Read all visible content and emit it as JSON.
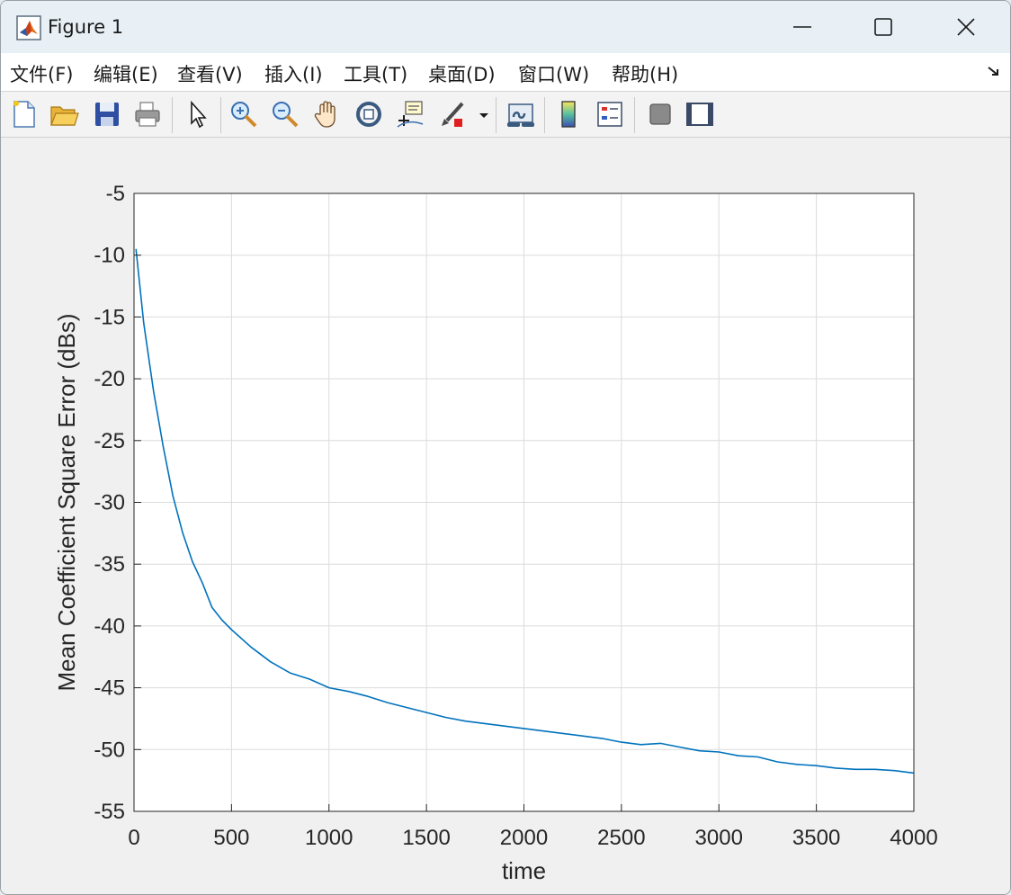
{
  "window": {
    "title": "Figure 1",
    "controls": {
      "minimize": "minimize",
      "maximize": "maximize",
      "close": "close"
    }
  },
  "menu": [
    {
      "label": "文件(F)"
    },
    {
      "label": "编辑(E)"
    },
    {
      "label": "查看(V)"
    },
    {
      "label": "插入(I)"
    },
    {
      "label": "工具(T)"
    },
    {
      "label": "桌面(D)"
    },
    {
      "label": "窗口(W)"
    },
    {
      "label": "帮助(H)"
    }
  ],
  "toolbar": [
    {
      "icon": "new-figure-icon"
    },
    {
      "icon": "open-folder-icon"
    },
    {
      "icon": "save-icon"
    },
    {
      "icon": "print-icon"
    },
    {
      "icon": "pointer-icon"
    },
    {
      "icon": "zoom-in-icon"
    },
    {
      "icon": "zoom-out-icon"
    },
    {
      "icon": "pan-hand-icon"
    },
    {
      "icon": "rotate-3d-icon"
    },
    {
      "icon": "data-cursor-icon"
    },
    {
      "icon": "brush-icon"
    },
    {
      "icon": "link-plot-icon"
    },
    {
      "icon": "colorbar-icon"
    },
    {
      "icon": "legend-icon"
    },
    {
      "icon": "hide-plot-tools-icon"
    },
    {
      "icon": "show-plot-tools-icon"
    }
  ],
  "colors": {
    "line": "#0072bd",
    "grid": "#dcdcdc",
    "axes": "#262626"
  },
  "chart_data": {
    "type": "line",
    "title": "",
    "xlabel": "time",
    "ylabel": "Mean Coefficient Square Error (dBs)",
    "xlim": [
      0,
      4000
    ],
    "ylim": [
      -55,
      -5
    ],
    "xticks": [
      "0",
      "500",
      "1000",
      "1500",
      "2000",
      "2500",
      "3000",
      "3500",
      "4000"
    ],
    "yticks": [
      "-5",
      "-10",
      "-15",
      "-20",
      "-25",
      "-30",
      "-35",
      "-40",
      "-45",
      "-50",
      "-55"
    ],
    "grid": true,
    "series": [
      {
        "x": [
          10,
          50,
          100,
          150,
          200,
          250,
          300,
          350,
          400,
          450,
          500,
          600,
          700,
          800,
          900,
          1000,
          1100,
          1200,
          1300,
          1400,
          1500,
          1600,
          1700,
          1800,
          1900,
          2000,
          2100,
          2200,
          2300,
          2400,
          2500,
          2600,
          2700,
          2800,
          2900,
          3000,
          3100,
          3200,
          3300,
          3400,
          3500,
          3600,
          3700,
          3800,
          3900,
          4000
        ],
        "y": [
          -9.5,
          -15.5,
          -21.0,
          -25.5,
          -29.5,
          -32.5,
          -34.8,
          -36.5,
          -38.5,
          -39.5,
          -40.3,
          -41.7,
          -42.9,
          -43.8,
          -44.3,
          -45.0,
          -45.3,
          -45.7,
          -46.2,
          -46.6,
          -47.0,
          -47.4,
          -47.7,
          -47.9,
          -48.1,
          -48.3,
          -48.5,
          -48.7,
          -48.9,
          -49.1,
          -49.4,
          -49.6,
          -49.5,
          -49.8,
          -50.1,
          -50.2,
          -50.5,
          -50.6,
          -51.0,
          -51.2,
          -51.3,
          -51.5,
          -51.6,
          -51.6,
          -51.7,
          -51.9
        ]
      }
    ]
  }
}
